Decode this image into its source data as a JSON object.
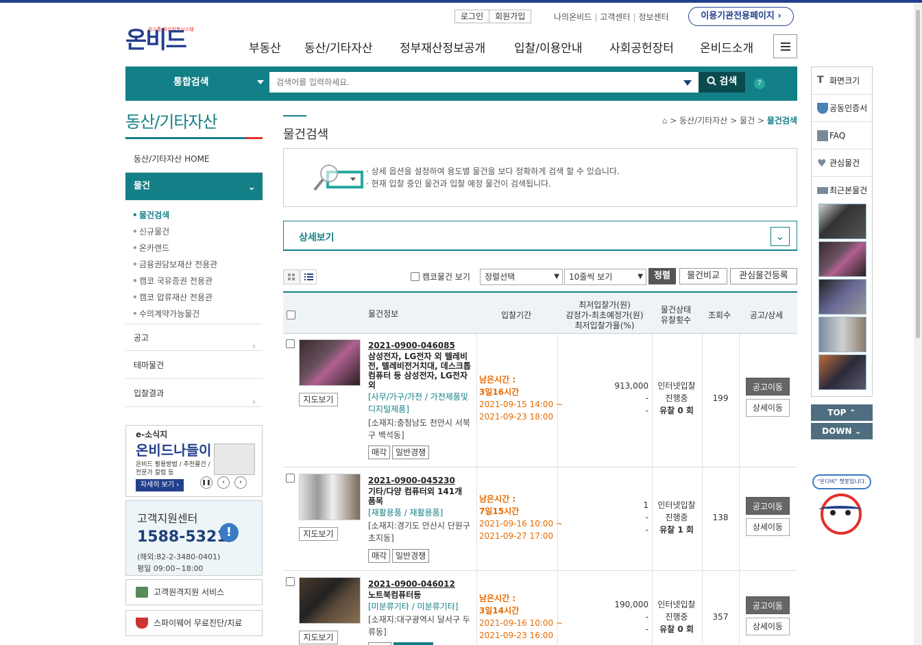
{
  "header": {
    "logo_tagline": "원스톱 자산처분시스템",
    "logo_text": "온비드",
    "login": "로그인",
    "join": "회원가입",
    "util_links": [
      "나의온비드",
      "고객센터",
      "정보센터"
    ],
    "agency_page": "이용기관전용페이지",
    "gnb": [
      "부동산",
      "동산/기타자산",
      "정부재산정보공개",
      "입찰/이용안내",
      "사회공헌장터",
      "온비드소개"
    ]
  },
  "search": {
    "category": "통합검색",
    "placeholder": "검색어를 입력하세요.",
    "button": "검색",
    "help": "?"
  },
  "lnb": {
    "title": "동산/기타자산",
    "home": "동산/기타자산 HOME",
    "active": "물건",
    "sub": [
      "물건검색",
      "신규물건",
      "온카랜드",
      "금융권담보재산 전용관",
      "캠코 국유증권 전용관",
      "캠코 압류재산 전용관",
      "수의계약가능물건"
    ],
    "items": [
      "공고",
      "테마물건",
      "입찰결과"
    ]
  },
  "banner": {
    "eyebrow": "e-소식지",
    "title": "온비드나들이",
    "desc1": "온비드 활용방법 / 추천물건 /",
    "desc2": "전문가 칼럼 등",
    "more": "자세히 보기"
  },
  "cs": {
    "title": "고객지원센터",
    "phone": "1588-5321",
    "overseas": "(해외:82-2-3480-0401)",
    "hours": "평일 09:00~18:00"
  },
  "services": [
    "고객원격지원 서비스",
    "스파이웨어 무료진단/치료"
  ],
  "main": {
    "title": "물건검색",
    "breadcrumb": [
      "동산/기타자산",
      "물건",
      "물건검색"
    ],
    "info1": "상세 옵션을 설정하여 용도별 물건을 보다 정확하게 검색 할 수 있습니다.",
    "info2": "현재 입찰 중인 물건과 입찰 예정 물건이 검색됩니다.",
    "detail": "상세보기",
    "camco_check": "캠코물건 보기",
    "sort_select": "정렬선택",
    "rows_select": "10줄씩 보기",
    "sort_btn": "정렬",
    "compare_btn": "물건비교",
    "fav_btn": "관심물건등록"
  },
  "table": {
    "headers": {
      "info": "물건정보",
      "period": "입찰기간",
      "price1": "최저입찰가(원)",
      "price2": "감정가-최초예정가(원)",
      "price3": "최저입찰가율(%)",
      "status1": "물건상태",
      "status2": "유찰횟수",
      "views": "조회수",
      "notice": "공고/상세"
    },
    "map_label": "지도보기",
    "goto_notice": "공고이동",
    "goto_detail": "상세이동",
    "rows": [
      {
        "id": "2021-0900-046085",
        "name": "삼성전자, LG전자 외 텔레비전, 텔레비전거치대, 데스크톱컴퓨터 등 삼성전자, LG전자 외",
        "category": "[사무/가구/가전 / 가전제품및디지털제품]",
        "location": "[소재지:충청남도 천안시 서북구 백석동]",
        "tags": [
          "매각",
          "일반경쟁"
        ],
        "remain_label": "남은시간 :",
        "remain": "3일16시간",
        "start": "2021-09-15 14:00 ~",
        "end": "2021-09-23 18:00",
        "price": "913,000",
        "price2": "-",
        "price3": "-",
        "status": "인터넷입찰",
        "status2": "진행중",
        "fail": "유찰 0 회",
        "views": "199"
      },
      {
        "id": "2021-0900-045230",
        "name": "기타/다양 컴퓨터외 141개 품목",
        "category": "[재활용품 / 재활용품]",
        "location": "[소재지:경기도 안산시 단원구 초지동]",
        "tags": [
          "매각",
          "일반경쟁"
        ],
        "remain_label": "남은시간 :",
        "remain": "7일15시간",
        "start": "2021-09-16 10:00 ~",
        "end": "2021-09-27 17:00",
        "price": "1",
        "price2": "-",
        "price3": "-",
        "status": "인터넷입찰",
        "status2": "진행중",
        "fail": "유찰 1 회",
        "views": "138"
      },
      {
        "id": "2021-0900-046012",
        "name": "노트북컴퓨터등",
        "category": "[미분류기타 / 미분류기타]",
        "location": "[소재지:대구광역시 달서구 두류동]",
        "tags": [],
        "remain_label": "남은시간 :",
        "remain": "3일14시간",
        "start": "2021-09-16 10:00 ~",
        "end": "2021-09-23 16:00",
        "price": "190,000",
        "price2": "-",
        "price3": "-",
        "status": "인터넷입찰",
        "status2": "진행중",
        "fail": "유찰 0 회",
        "views": "357"
      }
    ]
  },
  "quick": {
    "items": [
      "화면크기",
      "공동인증서",
      "FAQ",
      "관심물건",
      "최근본물건"
    ],
    "top": "TOP",
    "down": "DOWN",
    "chatbot": "\"온다비\" 챗봇입니다."
  },
  "colors": {
    "primary": "#137f86",
    "navy": "#23408e",
    "accent": "#e76a00"
  }
}
